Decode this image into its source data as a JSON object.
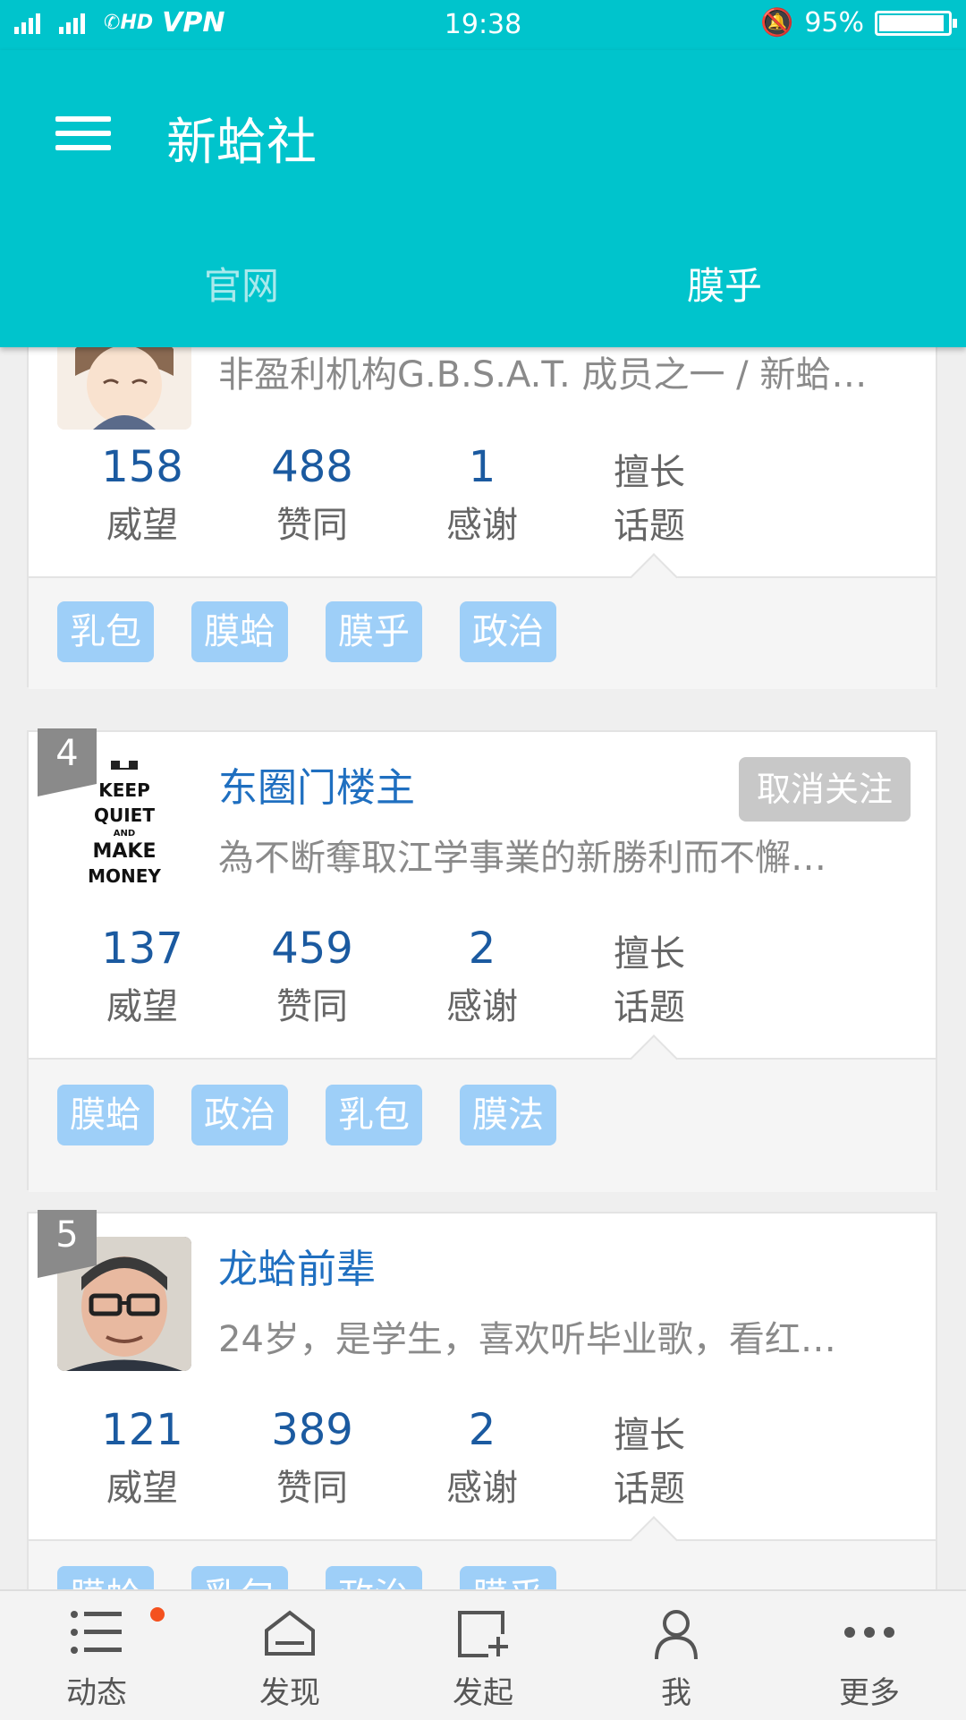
{
  "status_bar": {
    "network_left": "2G",
    "network_right": "4G",
    "hd": "HD",
    "vpn": "VPN",
    "time": "19:38",
    "battery": "95%",
    "battery_level": 0.95
  },
  "app_bar": {
    "title": "新蛤社"
  },
  "tabs": [
    {
      "label": "官网",
      "active": false
    },
    {
      "label": "膜乎",
      "active": true
    }
  ],
  "users": [
    {
      "rank": "",
      "name": "",
      "bio": "非盈利机构G.B.S.A.T. 成员之一 / 新蛤…",
      "follow_label": "",
      "stats": [
        {
          "value": "158",
          "label": "威望"
        },
        {
          "value": "488",
          "label": "赞同"
        },
        {
          "value": "1",
          "label": "感谢"
        }
      ],
      "skill": [
        "擅长",
        "话题"
      ],
      "tags": [
        "乳包",
        "膜蛤",
        "膜乎",
        "政治"
      ]
    },
    {
      "rank": "4",
      "name": "东圈门楼主",
      "bio": "為不断奪取江学事業的新勝利而不懈…",
      "follow_label": "取消关注",
      "avatar_text": [
        "KEEP",
        "QUIET",
        "AND",
        "MAKE",
        "MONEY"
      ],
      "stats": [
        {
          "value": "137",
          "label": "威望"
        },
        {
          "value": "459",
          "label": "赞同"
        },
        {
          "value": "2",
          "label": "感谢"
        }
      ],
      "skill": [
        "擅长",
        "话题"
      ],
      "tags": [
        "膜蛤",
        "政治",
        "乳包",
        "膜法"
      ]
    },
    {
      "rank": "5",
      "name": "龙蛤前辈",
      "bio": "24岁，是学生，喜欢听毕业歌，看红…",
      "follow_label": "",
      "stats": [
        {
          "value": "121",
          "label": "威望"
        },
        {
          "value": "389",
          "label": "赞同"
        },
        {
          "value": "2",
          "label": "感谢"
        }
      ],
      "skill": [
        "擅长",
        "话题"
      ],
      "tags": [
        "膜蛤",
        "乳包",
        "政治",
        "膜乎"
      ]
    }
  ],
  "bottom_nav": [
    {
      "label": "动态",
      "icon": "list-icon",
      "badge": true
    },
    {
      "label": "发现",
      "icon": "home-icon",
      "badge": false
    },
    {
      "label": "发起",
      "icon": "new-post-icon",
      "badge": false
    },
    {
      "label": "我",
      "icon": "person-icon",
      "badge": false
    },
    {
      "label": "更多",
      "icon": "more-icon",
      "badge": false
    }
  ],
  "colors": {
    "accent": "#00c4cc",
    "link": "#1f6fc0",
    "stat_number": "#1b5aa0",
    "tag_bg": "#9ecff8",
    "badge": "#f4511e"
  }
}
